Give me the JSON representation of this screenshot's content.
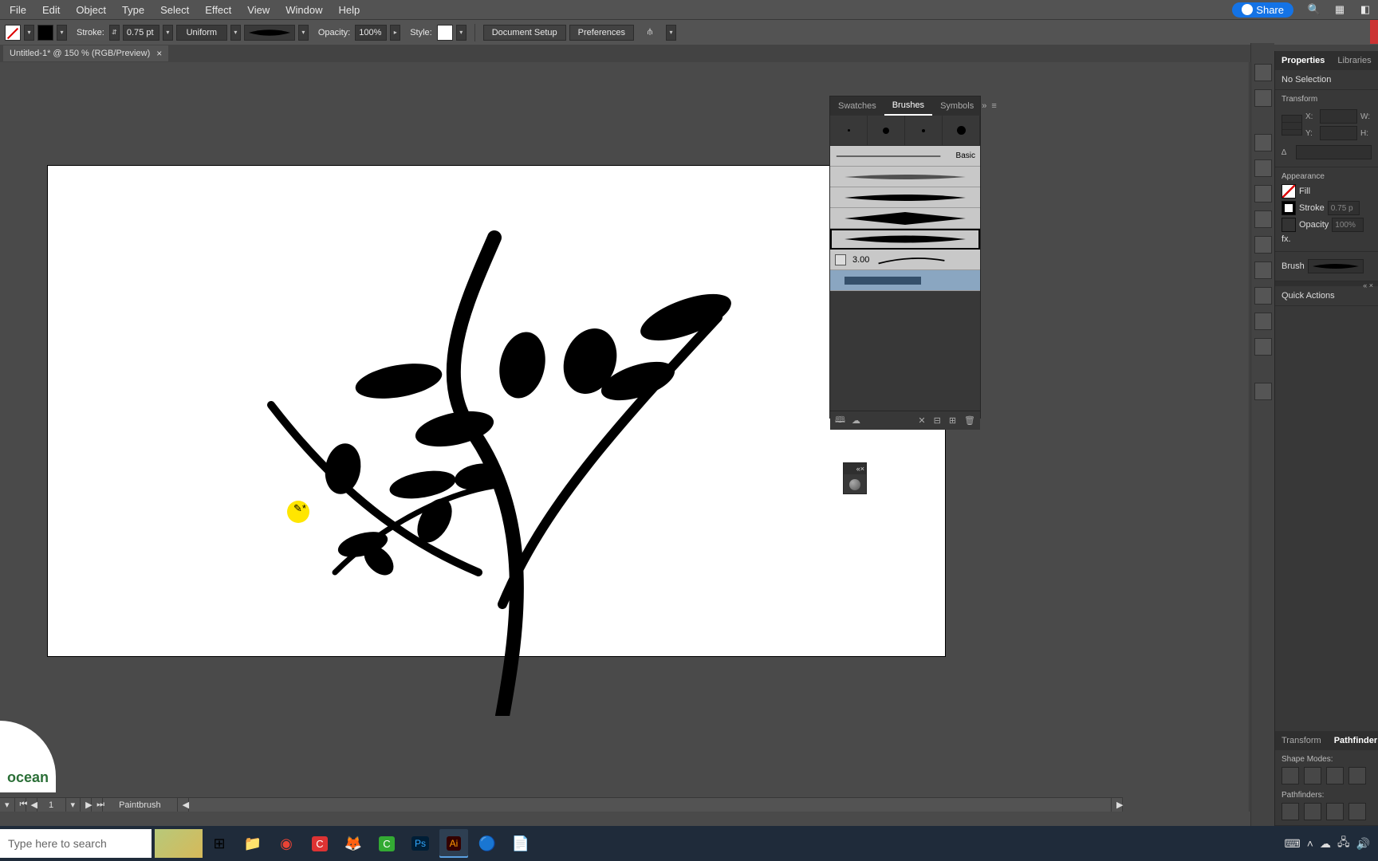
{
  "menus": {
    "file": "File",
    "edit": "Edit",
    "object": "Object",
    "type": "Type",
    "select": "Select",
    "effect": "Effect",
    "view": "View",
    "window": "Window",
    "help": "Help"
  },
  "share_label": "Share",
  "control": {
    "stroke_label": "Stroke:",
    "stroke_value": "0.75 pt",
    "profile_label": "Uniform",
    "opacity_label": "Opacity:",
    "opacity_value": "100%",
    "style_label": "Style:",
    "doc_setup": "Document Setup",
    "prefs": "Preferences"
  },
  "doc_tab": "Untitled-1* @ 150 % (RGB/Preview)",
  "brushes_panel": {
    "tabs": {
      "swatches": "Swatches",
      "brushes": "Brushes",
      "symbols": "Symbols"
    },
    "basic": "Basic",
    "point_value": "3.00"
  },
  "status": {
    "artboard": "1",
    "tool": "Paintbrush"
  },
  "props": {
    "tabs": {
      "properties": "Properties",
      "libraries": "Libraries"
    },
    "no_selection": "No Selection",
    "transform": "Transform",
    "x": "X:",
    "y": "Y:",
    "w": "W:",
    "h": "H:",
    "angle": "∆",
    "appearance": "Appearance",
    "fill": "Fill",
    "stroke": "Stroke",
    "stroke_val": "0.75 p",
    "opacity": "Opacity",
    "opacity_val": "100%",
    "fx": "fx.",
    "brush": "Brush",
    "quick": "Quick Actions",
    "pf_tabs": {
      "transform": "Transform",
      "pathfinder": "Pathfinder"
    },
    "shape_modes": "Shape Modes:",
    "pathfinders": "Pathfinders:"
  },
  "watermark": "ocean",
  "taskbar": {
    "search_placeholder": "Type here to search"
  },
  "colors": {
    "accent": "#1473e6",
    "panel": "#383838",
    "canvas": "#ffffff"
  }
}
